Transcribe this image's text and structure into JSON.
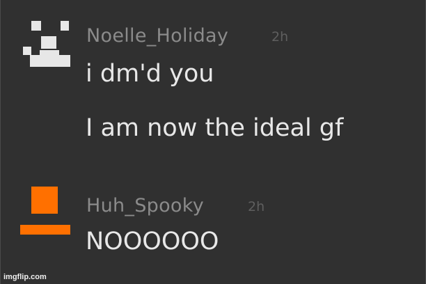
{
  "messages": [
    {
      "username": "Noelle_Holiday",
      "time": "2h",
      "avatar": "pixel-face-avatar",
      "lines": [
        "i dm'd you",
        "I am now the ideal gf"
      ]
    },
    {
      "username": "Huh_Spooky",
      "time": "2h",
      "avatar": "orange-hat-avatar",
      "lines": [
        "NOOOOOO"
      ]
    }
  ],
  "colors": {
    "background": "#303030",
    "username": "#8b8b8b",
    "timestamp": "#5f5f5f",
    "message": "#e8e8e8",
    "avatar_face": "#e7e7e7",
    "avatar_hat": "#ff7000"
  },
  "watermark": "imgflip.com"
}
